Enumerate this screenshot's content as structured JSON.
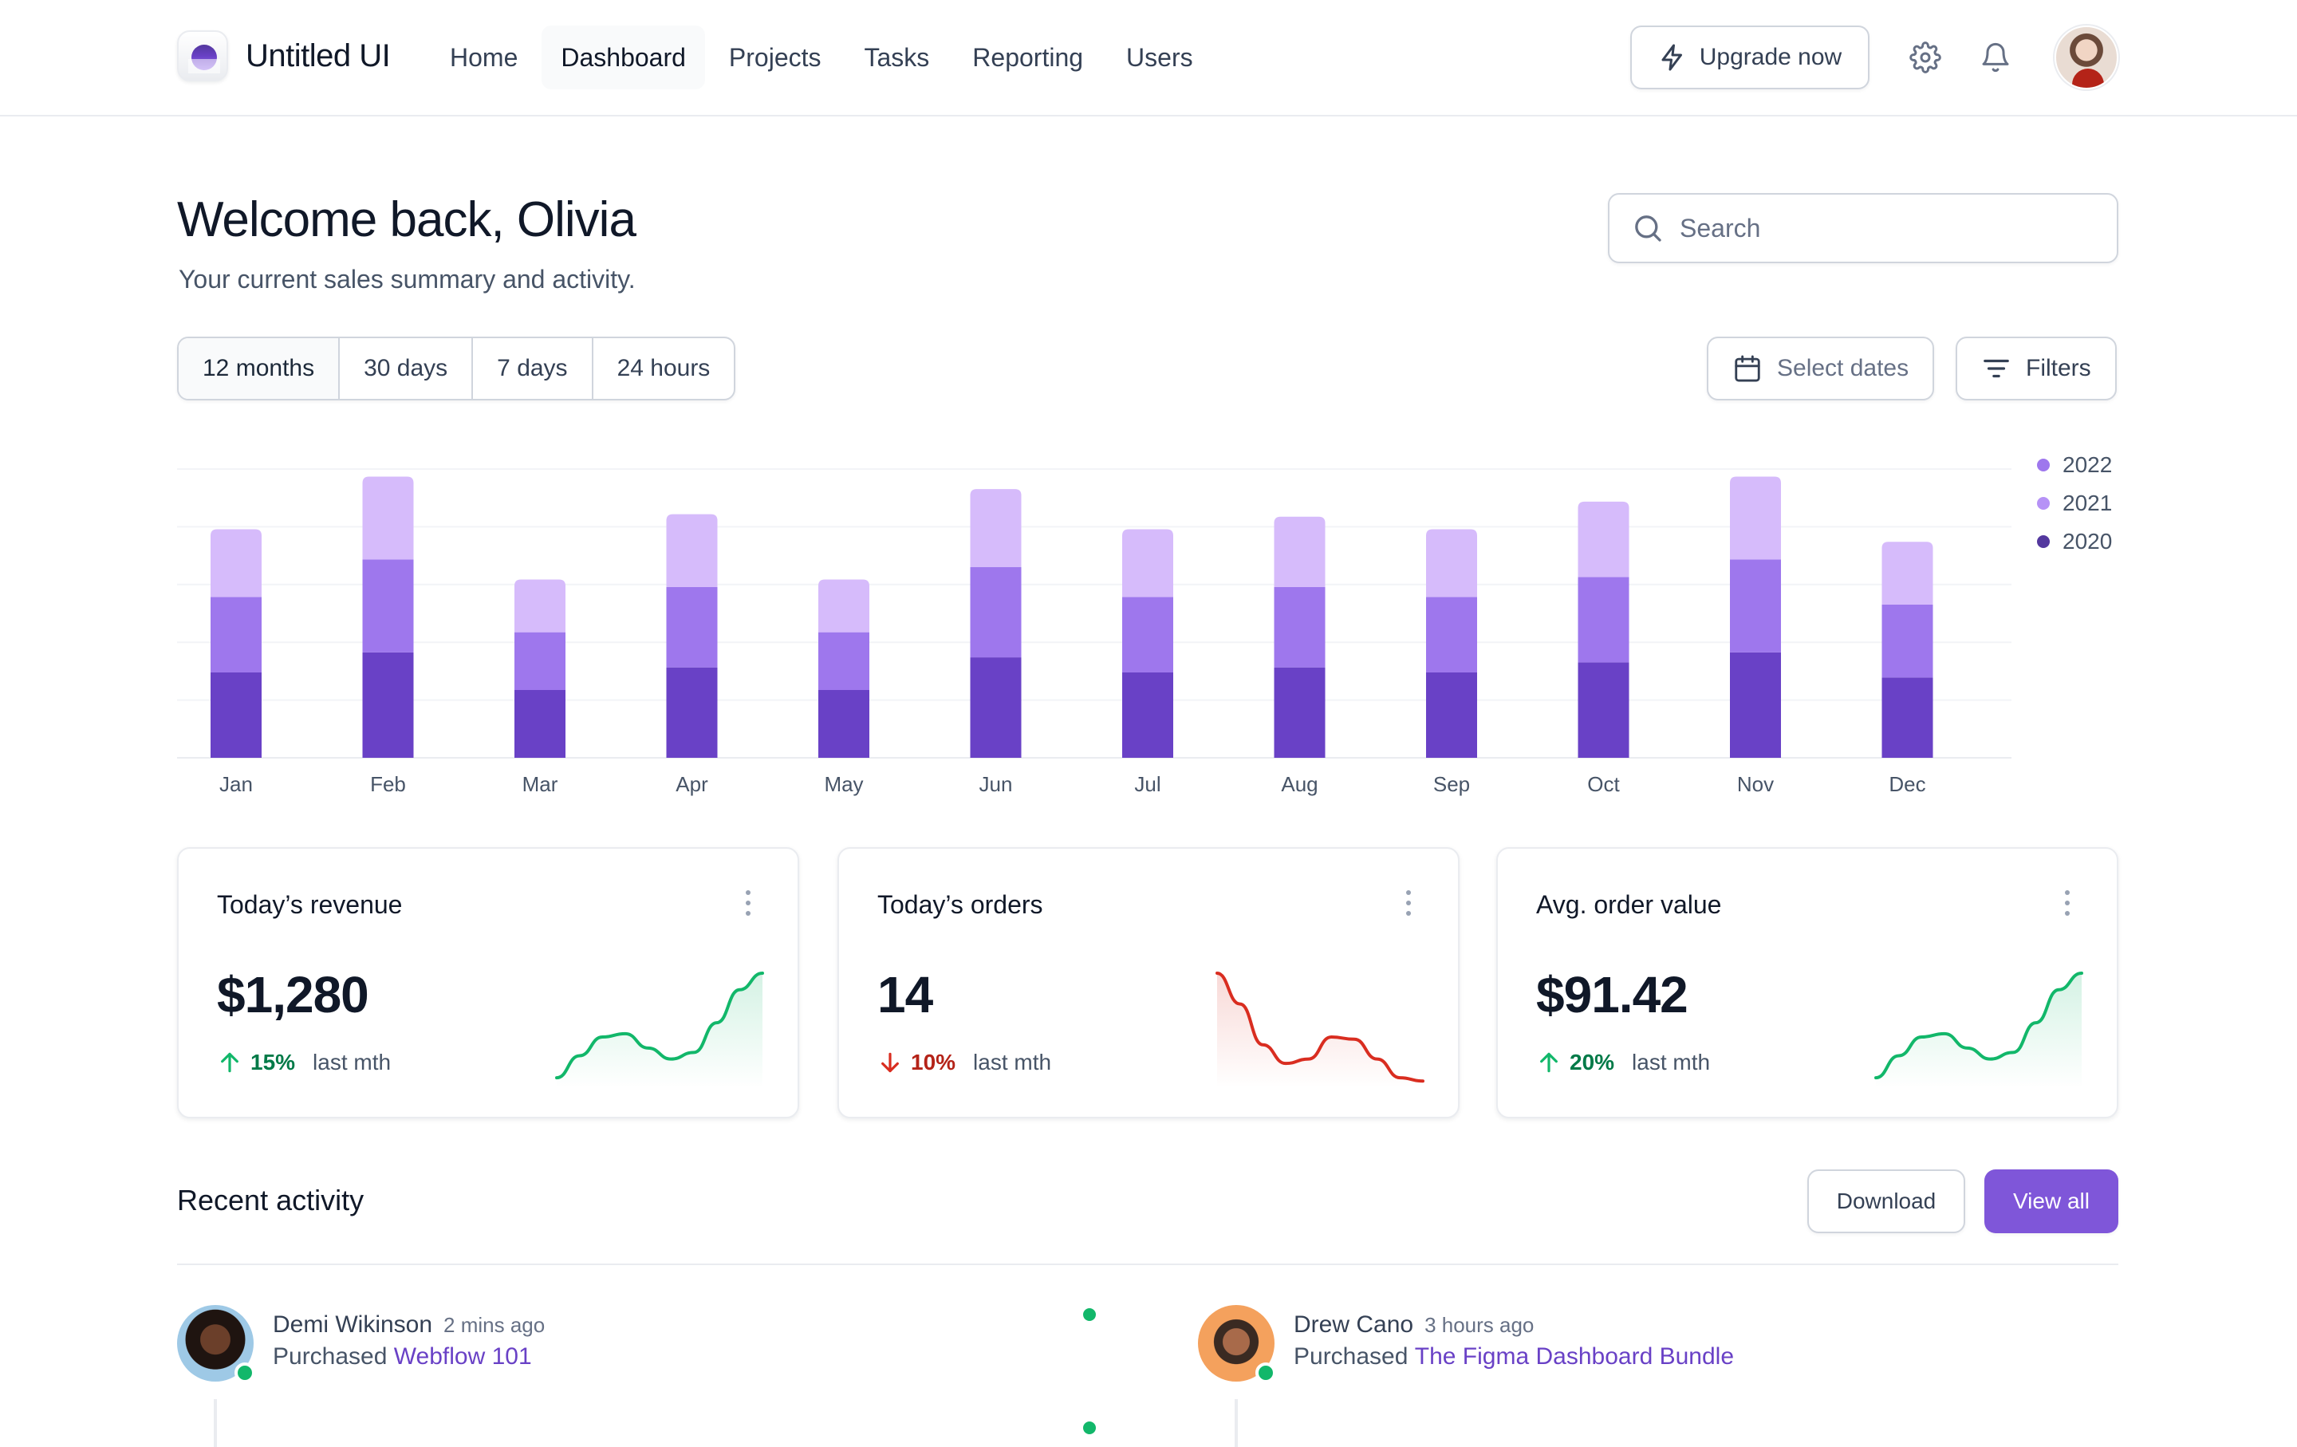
{
  "app": {
    "name": "Untitled UI"
  },
  "nav": {
    "items": [
      {
        "label": "Home",
        "active": false
      },
      {
        "label": "Dashboard",
        "active": true
      },
      {
        "label": "Projects",
        "active": false
      },
      {
        "label": "Tasks",
        "active": false
      },
      {
        "label": "Reporting",
        "active": false
      },
      {
        "label": "Users",
        "active": false
      }
    ],
    "upgrade_label": "Upgrade now",
    "icons": [
      "lightning-icon",
      "gear-icon",
      "bell-icon"
    ]
  },
  "header": {
    "title": "Welcome back, Olivia",
    "subtitle": "Your current sales summary and activity.",
    "search_placeholder": "Search"
  },
  "range": {
    "options": [
      "12 months",
      "30 days",
      "7 days",
      "24 hours"
    ],
    "selected": "12 months",
    "select_dates_label": "Select dates",
    "filters_label": "Filters"
  },
  "colors": {
    "s2022": "#d6bbfb",
    "s2021": "#9e77ed",
    "s2020": "#6941c6",
    "accent": "#7f56d9",
    "up": "#12b76a",
    "down": "#d92d20"
  },
  "chart_data": {
    "type": "bar",
    "stacked": true,
    "categories": [
      "Jan",
      "Feb",
      "Mar",
      "Apr",
      "May",
      "Jun",
      "Jul",
      "Aug",
      "Sep",
      "Oct",
      "Nov",
      "Dec"
    ],
    "series": [
      {
        "name": "2020",
        "color": "#6941c6",
        "values": [
          34,
          42,
          27,
          36,
          27,
          40,
          34,
          36,
          34,
          38,
          42,
          32
        ]
      },
      {
        "name": "2021",
        "color": "#9e77ed",
        "values": [
          30,
          37,
          23,
          32,
          23,
          36,
          30,
          32,
          30,
          34,
          37,
          29
        ]
      },
      {
        "name": "2022",
        "color": "#d6bbfb",
        "values": [
          27,
          33,
          21,
          29,
          21,
          31,
          27,
          28,
          27,
          30,
          33,
          25
        ]
      }
    ],
    "legend": [
      "2022",
      "2021",
      "2020"
    ],
    "legend_position": "right",
    "ylim": [
      0,
      115
    ],
    "grid": true,
    "xlabel": "",
    "ylabel": ""
  },
  "metrics": [
    {
      "title": "Today’s revenue",
      "value": "$1,280",
      "change": "15%",
      "direction": "up",
      "period": "last mth",
      "trend": [
        0.05,
        0.25,
        0.42,
        0.45,
        0.32,
        0.22,
        0.28,
        0.55,
        0.85,
        1.0
      ]
    },
    {
      "title": "Today’s orders",
      "value": "14",
      "change": "10%",
      "direction": "down",
      "period": "last mth",
      "trend": [
        1.0,
        0.72,
        0.35,
        0.18,
        0.22,
        0.42,
        0.4,
        0.22,
        0.05,
        0.02
      ]
    },
    {
      "title": "Avg. order value",
      "value": "$91.42",
      "change": "20%",
      "direction": "up",
      "period": "last mth",
      "trend": [
        0.05,
        0.25,
        0.42,
        0.45,
        0.32,
        0.22,
        0.28,
        0.55,
        0.85,
        1.0
      ]
    }
  ],
  "activity": {
    "title": "Recent activity",
    "download_label": "Download",
    "view_all_label": "View all",
    "items": [
      {
        "name": "Demi Wikinson",
        "time": "2 mins ago",
        "action": "Purchased",
        "product": "Webflow 101"
      },
      {
        "name": "Drew Cano",
        "time": "3 hours ago",
        "action": "Purchased",
        "product": "The Figma Dashboard Bundle"
      }
    ]
  }
}
